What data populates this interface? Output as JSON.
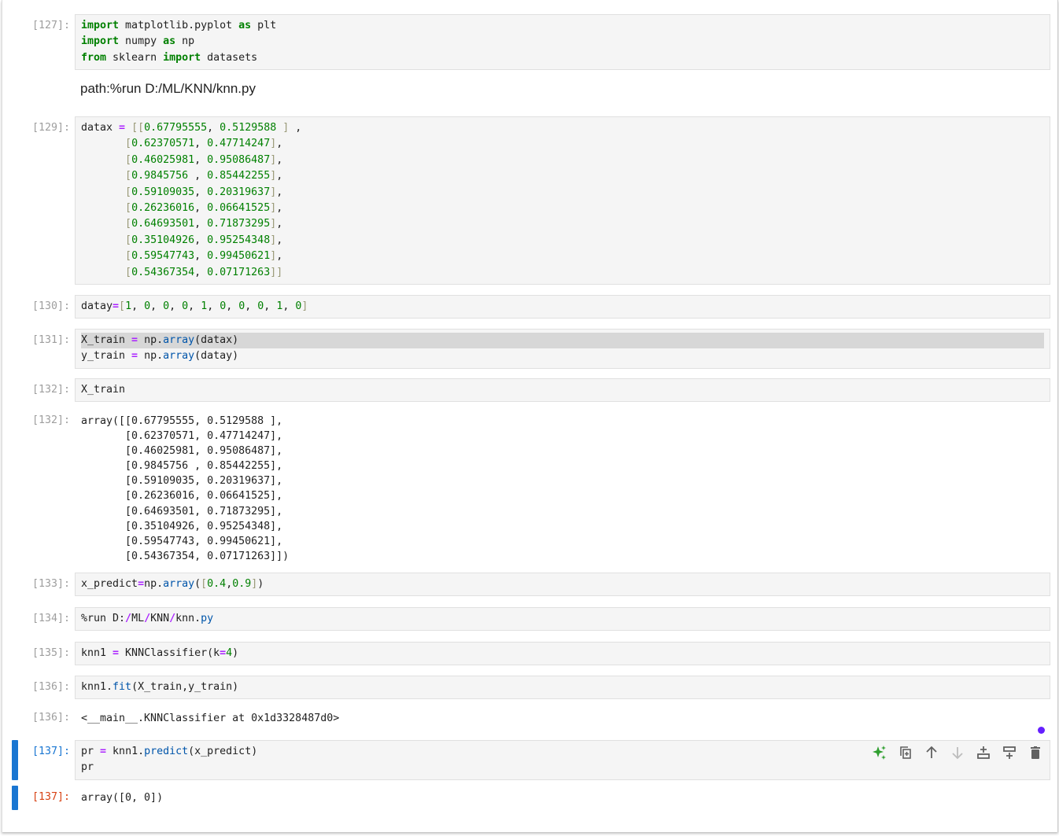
{
  "cells": [
    {
      "id": "c127",
      "prompt": "[127]:",
      "lines": [
        [
          [
            "kw",
            "import"
          ],
          [
            "",
            " matplotlib.pyplot "
          ],
          [
            "kw",
            "as"
          ],
          [
            "",
            " plt"
          ]
        ],
        [
          [
            "kw",
            "import"
          ],
          [
            "",
            " numpy "
          ],
          [
            "kw",
            "as"
          ],
          [
            "",
            " np"
          ]
        ],
        [
          [
            "kw",
            "from"
          ],
          [
            "",
            " sklearn "
          ],
          [
            "kw",
            "import"
          ],
          [
            "",
            " datasets"
          ]
        ]
      ]
    },
    {
      "id": "c129",
      "prompt": "[129]:",
      "lines": [
        [
          [
            "",
            "datax "
          ],
          [
            "op",
            "="
          ],
          [
            "",
            " "
          ],
          [
            "br",
            "[["
          ],
          [
            "num",
            "0.67795555"
          ],
          [
            "",
            ", "
          ],
          [
            "num",
            "0.5129588"
          ],
          [
            "",
            " "
          ],
          [
            "br",
            "]"
          ],
          [
            "",
            " ,"
          ]
        ],
        [
          [
            "",
            "       "
          ],
          [
            "br",
            "["
          ],
          [
            "num",
            "0.62370571"
          ],
          [
            "",
            ", "
          ],
          [
            "num",
            "0.47714247"
          ],
          [
            "br",
            "]"
          ],
          [
            "",
            ","
          ]
        ],
        [
          [
            "",
            "       "
          ],
          [
            "br",
            "["
          ],
          [
            "num",
            "0.46025981"
          ],
          [
            "",
            ", "
          ],
          [
            "num",
            "0.95086487"
          ],
          [
            "br",
            "]"
          ],
          [
            "",
            ","
          ]
        ],
        [
          [
            "",
            "       "
          ],
          [
            "br",
            "["
          ],
          [
            "num",
            "0.9845756"
          ],
          [
            "",
            " , "
          ],
          [
            "num",
            "0.85442255"
          ],
          [
            "br",
            "]"
          ],
          [
            "",
            ","
          ]
        ],
        [
          [
            "",
            "       "
          ],
          [
            "br",
            "["
          ],
          [
            "num",
            "0.59109035"
          ],
          [
            "",
            ", "
          ],
          [
            "num",
            "0.20319637"
          ],
          [
            "br",
            "]"
          ],
          [
            "",
            ","
          ]
        ],
        [
          [
            "",
            "       "
          ],
          [
            "br",
            "["
          ],
          [
            "num",
            "0.26236016"
          ],
          [
            "",
            ", "
          ],
          [
            "num",
            "0.06641525"
          ],
          [
            "br",
            "]"
          ],
          [
            "",
            ","
          ]
        ],
        [
          [
            "",
            "       "
          ],
          [
            "br",
            "["
          ],
          [
            "num",
            "0.64693501"
          ],
          [
            "",
            ", "
          ],
          [
            "num",
            "0.71873295"
          ],
          [
            "br",
            "]"
          ],
          [
            "",
            ","
          ]
        ],
        [
          [
            "",
            "       "
          ],
          [
            "br",
            "["
          ],
          [
            "num",
            "0.35104926"
          ],
          [
            "",
            ", "
          ],
          [
            "num",
            "0.95254348"
          ],
          [
            "br",
            "]"
          ],
          [
            "",
            ","
          ]
        ],
        [
          [
            "",
            "       "
          ],
          [
            "br",
            "["
          ],
          [
            "num",
            "0.59547743"
          ],
          [
            "",
            ", "
          ],
          [
            "num",
            "0.99450621"
          ],
          [
            "br",
            "]"
          ],
          [
            "",
            ","
          ]
        ],
        [
          [
            "",
            "       "
          ],
          [
            "br",
            "["
          ],
          [
            "num",
            "0.54367354"
          ],
          [
            "",
            ", "
          ],
          [
            "num",
            "0.07171263"
          ],
          [
            "br",
            "]]"
          ]
        ]
      ]
    },
    {
      "id": "c130",
      "prompt": "[130]:",
      "lines": [
        [
          [
            "",
            "datay"
          ],
          [
            "op",
            "="
          ],
          [
            "br",
            "["
          ],
          [
            "num",
            "1"
          ],
          [
            "",
            ", "
          ],
          [
            "num",
            "0"
          ],
          [
            "",
            ", "
          ],
          [
            "num",
            "0"
          ],
          [
            "",
            ", "
          ],
          [
            "num",
            "0"
          ],
          [
            "",
            ", "
          ],
          [
            "num",
            "1"
          ],
          [
            "",
            ", "
          ],
          [
            "num",
            "0"
          ],
          [
            "",
            ", "
          ],
          [
            "num",
            "0"
          ],
          [
            "",
            ", "
          ],
          [
            "num",
            "0"
          ],
          [
            "",
            ", "
          ],
          [
            "num",
            "1"
          ],
          [
            "",
            ", "
          ],
          [
            "num",
            "0"
          ],
          [
            "br",
            "]"
          ]
        ]
      ]
    },
    {
      "id": "c131",
      "prompt": "[131]:",
      "lines": [
        [
          [
            "",
            "X_train "
          ],
          [
            "op",
            "="
          ],
          [
            "",
            " np."
          ],
          [
            "fn",
            "array"
          ],
          [
            "",
            "(datax)"
          ]
        ],
        [
          [
            "",
            "y_train "
          ],
          [
            "op",
            "="
          ],
          [
            "",
            " np."
          ],
          [
            "fn",
            "array"
          ],
          [
            "",
            "(datay)"
          ]
        ]
      ]
    },
    {
      "id": "c132",
      "prompt": "[132]:",
      "lines": [
        [
          [
            "",
            "X_train"
          ]
        ]
      ]
    },
    {
      "id": "c133",
      "prompt": "[133]:",
      "lines": [
        [
          [
            "",
            "x_predict"
          ],
          [
            "op",
            "="
          ],
          [
            "",
            "np."
          ],
          [
            "fn",
            "array"
          ],
          [
            "",
            "("
          ],
          [
            "br",
            "["
          ],
          [
            "num",
            "0.4"
          ],
          [
            "",
            ","
          ],
          [
            "num",
            "0.9"
          ],
          [
            "br",
            "]"
          ],
          [
            "",
            ")"
          ]
        ]
      ]
    },
    {
      "id": "c134",
      "prompt": "[134]:",
      "lines": [
        [
          [
            "",
            "%run D:"
          ],
          [
            "op",
            "/"
          ],
          [
            "",
            "ML"
          ],
          [
            "op",
            "/"
          ],
          [
            "",
            "KNN"
          ],
          [
            "op",
            "/"
          ],
          [
            "",
            "knn."
          ],
          [
            "fn",
            "py"
          ]
        ]
      ]
    },
    {
      "id": "c135",
      "prompt": "[135]:",
      "lines": [
        [
          [
            "",
            "knn1 "
          ],
          [
            "op",
            "="
          ],
          [
            "",
            " KNNClassifier(k"
          ],
          [
            "op",
            "="
          ],
          [
            "num",
            "4"
          ],
          [
            "",
            ")"
          ]
        ]
      ]
    },
    {
      "id": "c136",
      "prompt": "[136]:",
      "lines": [
        [
          [
            "",
            "knn1."
          ],
          [
            "fn",
            "fit"
          ],
          [
            "",
            "(X_train,y_train)"
          ]
        ]
      ]
    },
    {
      "id": "c137",
      "prompt": "[137]:",
      "lines": [
        [
          [
            "",
            "pr "
          ],
          [
            "op",
            "="
          ],
          [
            "",
            " knn1."
          ],
          [
            "fn",
            "predict"
          ],
          [
            "",
            "(x_predict)"
          ]
        ],
        [
          [
            "",
            "pr"
          ]
        ]
      ]
    }
  ],
  "markdown": "path:%run D:/ML/KNN/knn.py",
  "outputs": {
    "o132": {
      "prompt": "[132]:",
      "text": "array([[0.67795555, 0.5129588 ],\n       [0.62370571, 0.47714247],\n       [0.46025981, 0.95086487],\n       [0.9845756 , 0.85442255],\n       [0.59109035, 0.20319637],\n       [0.26236016, 0.06641525],\n       [0.64693501, 0.71873295],\n       [0.35104926, 0.95254348],\n       [0.59547743, 0.99450621],\n       [0.54367354, 0.07171263]])"
    },
    "o136": {
      "prompt": "[136]:",
      "text": "<__main__.KNNClassifier at 0x1d3328487d0>"
    },
    "o137": {
      "prompt": "[137]:",
      "text": "array([0, 0])"
    }
  },
  "toolbar": [
    "sparkle-ai-icon",
    "duplicate-icon",
    "move-up-icon",
    "move-down-icon",
    "insert-above-icon",
    "insert-below-icon",
    "delete-icon"
  ],
  "colors": {
    "active": "#1976d2",
    "out_prompt": "#d84315",
    "dot": "#651fff"
  }
}
